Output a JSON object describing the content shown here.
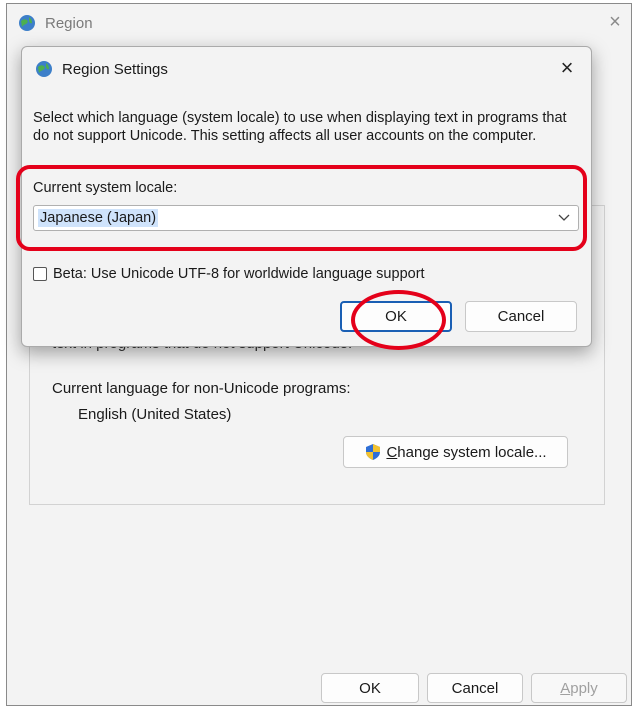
{
  "main_window": {
    "title": "Region",
    "close_glyph": "×",
    "partial_text": "text in programs that do not support Unicode.",
    "current_lang_label": "Current language for non-Unicode programs:",
    "current_lang_value": "English (United States)",
    "change_locale_prefix": "C",
    "change_locale_rest": "hange system locale...",
    "ok_label": "OK",
    "cancel_label": "Cancel",
    "apply_prefix": "A",
    "apply_rest": "pply"
  },
  "dialog": {
    "title": "Region Settings",
    "close_glyph": "×",
    "description": "Select which language (system locale) to use when displaying text in programs that do not support Unicode. This setting affects all user accounts on the computer.",
    "locale_label": "Current system locale:",
    "locale_value": "Japanese (Japan)",
    "beta_label": "Beta: Use Unicode UTF-8 for worldwide language support",
    "beta_checked": false,
    "ok_label": "OK",
    "cancel_label": "Cancel"
  },
  "icons": [
    "globe-icon",
    "shield-icon",
    "chevron-down-icon",
    "close-icon"
  ],
  "colors": {
    "highlight_red": "#e4001a",
    "default_button_border": "#1a5fb4",
    "selection_blue": "#cfe3fb"
  }
}
